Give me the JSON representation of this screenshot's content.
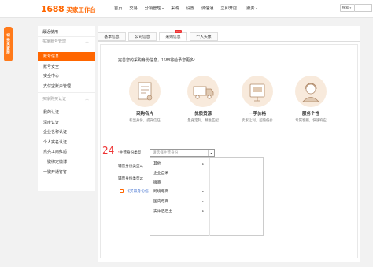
{
  "logo": {
    "number": "1688",
    "title": "买家工作台"
  },
  "nav": [
    {
      "label": "首页",
      "caret": false
    },
    {
      "label": "交易",
      "caret": false
    },
    {
      "label": "分销管理",
      "caret": true
    },
    {
      "label": "采购",
      "caret": false
    },
    {
      "label": "设置",
      "caret": false
    },
    {
      "label": "诚信通",
      "caret": false
    },
    {
      "label": "立即开店",
      "caret": false
    },
    {
      "label": "服务",
      "caret": true
    }
  ],
  "search": {
    "scope": "搜索"
  },
  "badge": [
    "切",
    "换",
    "卖",
    "家",
    "版"
  ],
  "sidebar": {
    "recent": "最近使用",
    "account_group": "买家账号管理",
    "items_account": [
      "账号信息",
      "账号安全",
      "安全中心",
      "支付宝账户管理"
    ],
    "auth_group": "买家购买认证",
    "items_auth": [
      "我的认证",
      "深度认证",
      "企业名称认证",
      "个人实名认证",
      "点亮工商红盾",
      "一键绑定微博",
      "一键开通钉钉"
    ]
  },
  "tabs": [
    {
      "label": "基本信息"
    },
    {
      "label": "公司信息"
    },
    {
      "label": "采购信息",
      "badge": "new"
    },
    {
      "label": "个人头像"
    }
  ],
  "intro": "完善您的采购身份信息，1688将给予您更多：",
  "features": [
    {
      "icon": "business-card-icon",
      "title": "采购名片",
      "desc": "彰显身份，提升信任"
    },
    {
      "icon": "truck-icon",
      "title": "优质货源",
      "desc": "量身定制，精准匹配"
    },
    {
      "icon": "price-tag-icon",
      "title": "一手价格",
      "desc": "卖家让利，超值低价"
    },
    {
      "icon": "customer-service-icon",
      "title": "服务个性",
      "desc": "专属客服，快速响应"
    }
  ],
  "form": {
    "step": "24",
    "identity_label": "*主营身份类型：",
    "select_placeholder": "请选择主营身份",
    "aux_label1": "辅营身份类型1：",
    "aux_label2": "辅营身份类型2：",
    "link_text": "《买家身份信"
  },
  "dropdown": [
    {
      "label": "其他",
      "arrow": true
    },
    {
      "label": "企业自采",
      "arrow": false
    },
    {
      "label": "微商",
      "arrow": false
    },
    {
      "label": "跨境电商",
      "arrow": true
    },
    {
      "label": "国内电商",
      "arrow": true
    },
    {
      "label": "实体店店主",
      "arrow": true
    }
  ],
  "colors": {
    "brand": "#ff6600",
    "link": "#3366cc",
    "danger": "#ee3333"
  }
}
